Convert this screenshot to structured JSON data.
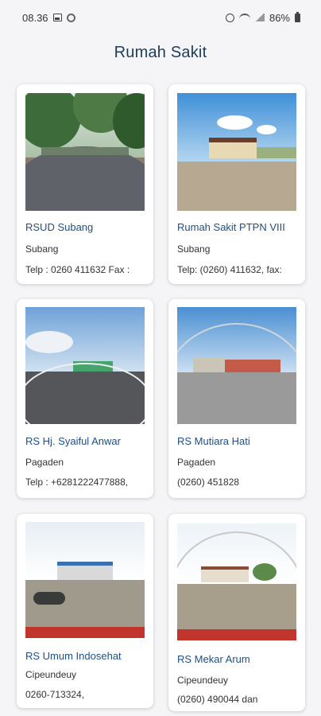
{
  "status_bar": {
    "time": "08.36",
    "battery": "86%"
  },
  "header": {
    "title": "Rumah Sakit"
  },
  "hospitals": [
    {
      "name": "RSUD Subang",
      "city": "Subang",
      "phone": "Telp : 0260 411632 Fax :"
    },
    {
      "name": "Rumah Sakit PTPN VIII",
      "city": "Subang",
      "phone": "Telp: (0260) 411632, fax:"
    },
    {
      "name": "RS Hj. Syaiful Anwar",
      "city": "Pagaden",
      "phone": "Telp :  +6281222477888,"
    },
    {
      "name": "RS Mutiara Hati",
      "city": "Pagaden",
      "phone": "(0260) 451828"
    },
    {
      "name": "RS Umum Indosehat",
      "city": "Cipeundeuy",
      "phone": "0260-713324,"
    },
    {
      "name": "RS Mekar Arum",
      "city": "Cipeundeuy",
      "phone": "(0260) 490044 dan"
    }
  ],
  "icons": {
    "gallery": "gallery-icon",
    "circle": "sync-circle-icon",
    "alarm": "alarm-icon",
    "wifi": "wifi-icon",
    "signal": "signal-icon",
    "battery": "battery-icon"
  }
}
